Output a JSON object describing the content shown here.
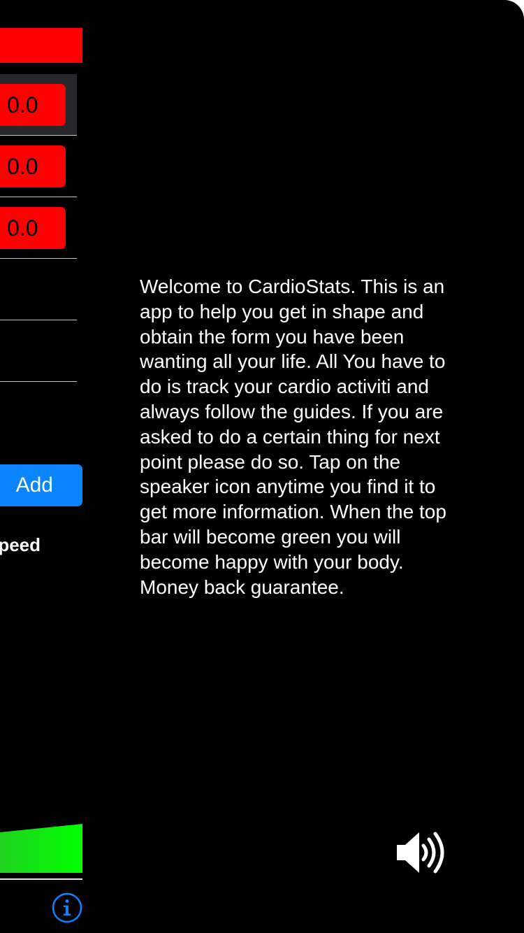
{
  "side_panel": {
    "rows": [
      {
        "value": "0.0"
      },
      {
        "value": "0.0"
      },
      {
        "value": "0.0"
      }
    ],
    "add_label": "Add",
    "speed_label": "Speed"
  },
  "intro": {
    "text": "Welcome to CardioStats. This is an\napp to help you get in shape and\nobtain the form you have been\nwanting all your life. All You have to\ndo is track your cardio activiti and\nalways follow the guides. If you are\nasked to do a certain thing for next\npoint please do so. Tap on the\nspeaker icon anytime you find it to\nget more information. When the top\nbar will become green you will\nbecome happy with your body.\nMoney back guarantee."
  },
  "icons": {
    "speaker": "speaker-icon",
    "info": "info-icon"
  },
  "colors": {
    "background": "#000000",
    "status_bar": "#ff0000",
    "value_box": "#ff0000",
    "add_button": "#0a84ff",
    "progress_green": "#00ff00",
    "info_blue": "#0a84ff"
  }
}
